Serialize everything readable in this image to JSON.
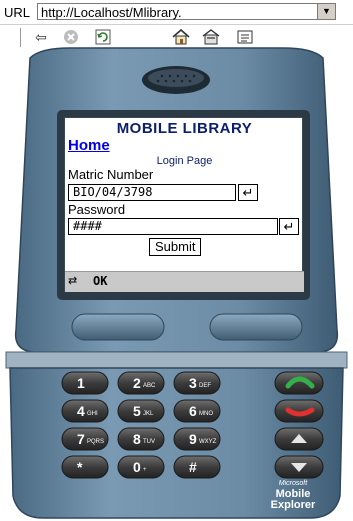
{
  "browser": {
    "url_label": "URL",
    "url": "http://Localhost/Mlibrary."
  },
  "toolbar": {
    "icons": [
      "back-icon",
      "stop-icon",
      "refresh-icon",
      "home-icon",
      "settings-icon",
      "favorites-icon"
    ]
  },
  "app": {
    "title": "MOBILE LIBRARY",
    "home_link": "Home",
    "caption": "Login Page",
    "matric_label": "Matric Number",
    "matric_value": "BIO/04/3798",
    "password_label": "Password",
    "password_value": "####",
    "submit_label": "Submit",
    "softkey_left": "OK"
  },
  "keypad": [
    {
      "digit": "1",
      "letters": ""
    },
    {
      "digit": "2",
      "letters": "ABC"
    },
    {
      "digit": "3",
      "letters": "DEF"
    },
    {
      "digit": "4",
      "letters": "GHI"
    },
    {
      "digit": "5",
      "letters": "JKL"
    },
    {
      "digit": "6",
      "letters": "MNO"
    },
    {
      "digit": "7",
      "letters": "PQRS"
    },
    {
      "digit": "8",
      "letters": "TUV"
    },
    {
      "digit": "9",
      "letters": "WXYZ"
    },
    {
      "digit": "*",
      "letters": ""
    },
    {
      "digit": "0",
      "letters": "+"
    },
    {
      "digit": "#",
      "letters": ""
    }
  ],
  "branding": {
    "line1": "Microsoft",
    "line2": "Mobile",
    "line3": "Explorer"
  },
  "colors": {
    "phone_body": "#6a8aa4",
    "call_green": "#2e8b57",
    "end_red": "#d42a2a",
    "title_blue": "#0b1f6b",
    "link_blue": "#0000ee"
  }
}
